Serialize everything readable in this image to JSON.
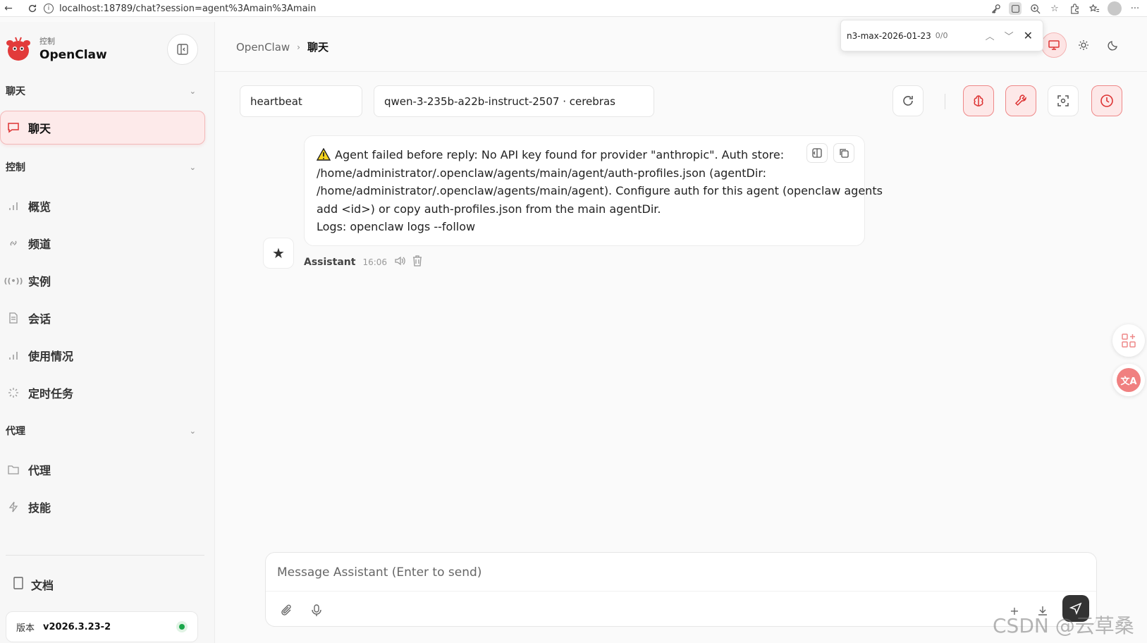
{
  "browser": {
    "url": "localhost:18789/chat?session=agent%3Amain%3Amain"
  },
  "find_bar": {
    "query": "n3-max-2026-01-23",
    "count": "0/0"
  },
  "sidebar": {
    "brand_subtitle": "控制",
    "brand_name": "OpenClaw",
    "groups": {
      "chat": "聊天",
      "control": "控制",
      "agent": "代理"
    },
    "items": {
      "chat": "聊天",
      "overview": "概览",
      "channels": "频道",
      "instances": "实例",
      "sessions": "会话",
      "usage": "使用情况",
      "cron": "定时任务",
      "agents": "代理",
      "skills": "技能"
    },
    "docs": "文档",
    "version_label": "版本",
    "version_value": "v2026.3.23-2"
  },
  "header": {
    "crumb_root": "OpenClaw",
    "crumb_sep": "›",
    "crumb_current": "聊天"
  },
  "chat": {
    "session_chip": "heartbeat",
    "model_chip": "qwen-3-235b-a22b-instruct-2507 · cerebras",
    "message": {
      "lines": [
        "Agent failed before reply: No API key found for provider \"anthropic\". Auth store:",
        "/home/administrator/.openclaw/agents/main/agent/auth-profiles.json (agentDir:",
        "/home/administrator/.openclaw/agents/main/agent). Configure auth for this agent (openclaw agents",
        "add <id>) or copy auth-profiles.json from the main agentDir.",
        "Logs: openclaw logs --follow"
      ],
      "sender": "Assistant",
      "time": "16:06"
    },
    "composer_placeholder": "Message Assistant (Enter to send)"
  },
  "colors": {
    "accent": "#d33333",
    "accent_bg": "#fdeaea",
    "status_ok": "#1aa64a"
  },
  "watermark": "CSDN @云草桑"
}
